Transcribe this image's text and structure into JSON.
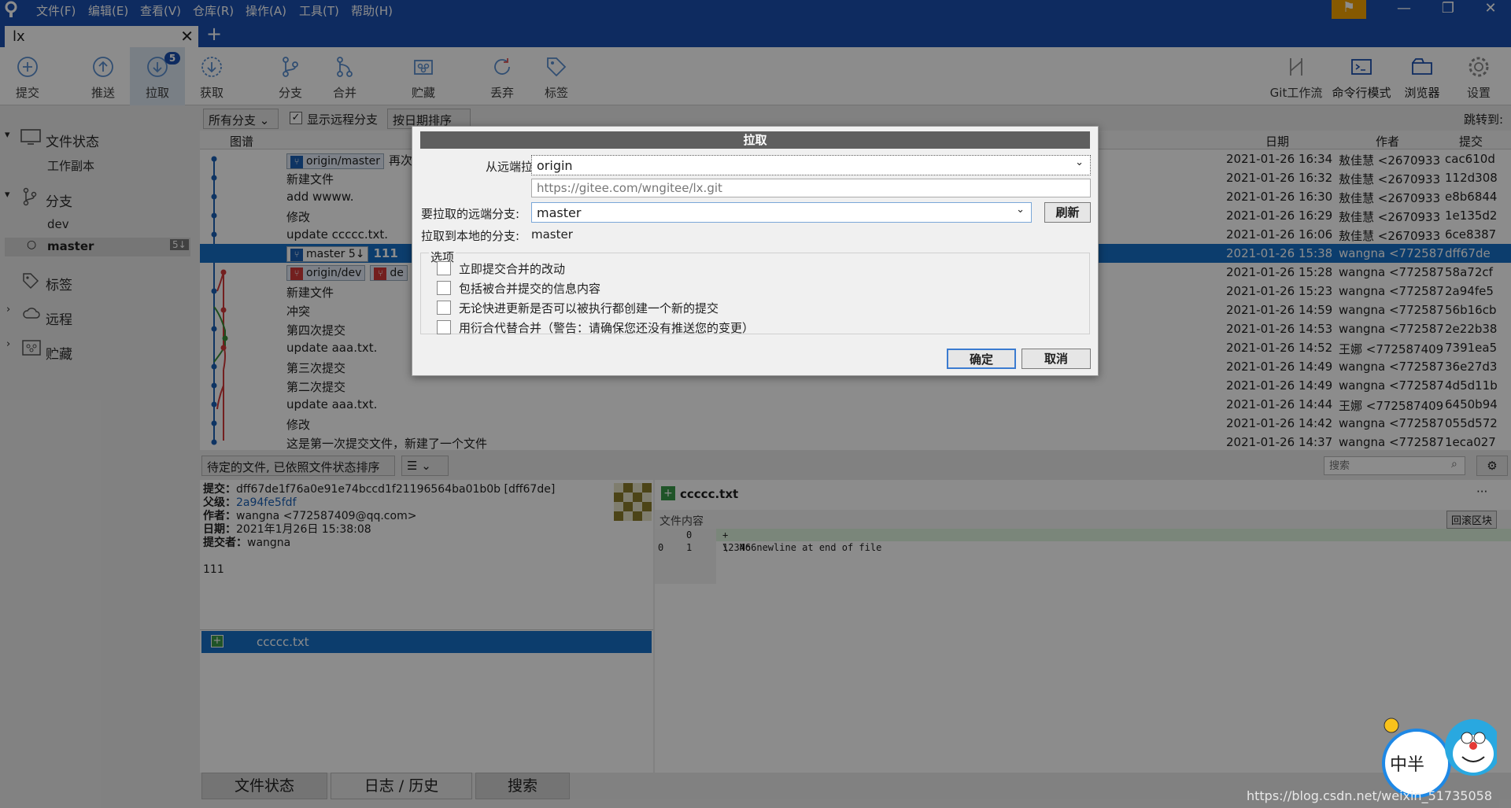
{
  "menu": [
    "文件(F)",
    "编辑(E)",
    "查看(V)",
    "仓库(R)",
    "操作(A)",
    "工具(T)",
    "帮助(H)"
  ],
  "tab": {
    "name": "lx",
    "close": "✕",
    "new": "+"
  },
  "toolbar": {
    "commit": "提交",
    "push": "推送",
    "pull": "拉取",
    "pull_badge": "5",
    "fetch": "获取",
    "branch": "分支",
    "merge": "合并",
    "stash": "贮藏",
    "discard": "丢弃",
    "tag": "标签",
    "gitflow": "Git工作流",
    "terminal": "命令行模式",
    "browser": "浏览器",
    "settings": "设置"
  },
  "sidebar": {
    "file_status": "文件状态",
    "working_copy": "工作副本",
    "branches": "分支",
    "branch_dev": "dev",
    "branch_master": "master",
    "master_badge": "5↓",
    "tags": "标签",
    "remotes": "远程",
    "stashes": "贮藏"
  },
  "filter": {
    "all_branches": "所有分支",
    "show_remote": "显示远程分支",
    "sort": "按日期排序",
    "jump": "跳转到:"
  },
  "list_header": {
    "graph": "图谱",
    "date": "日期",
    "author": "作者",
    "commit": "提交"
  },
  "commits": [
    {
      "ref": "origin/master",
      "msg": "再次",
      "date": "2021-01-26 16:34",
      "author": "敖佳慧 <2670933",
      "hash": "cac610d"
    },
    {
      "msg": "新建文件",
      "date": "2021-01-26 16:32",
      "author": "敖佳慧 <2670933",
      "hash": "112d308"
    },
    {
      "msg": "add wwww.",
      "date": "2021-01-26 16:30",
      "author": "敖佳慧 <2670933",
      "hash": "e8b6844"
    },
    {
      "msg": "修改",
      "date": "2021-01-26 16:29",
      "author": "敖佳慧 <2670933",
      "hash": "1e135d2"
    },
    {
      "msg": "update ccccc.txt.",
      "date": "2021-01-26 16:06",
      "author": "敖佳慧 <2670933",
      "hash": "6ce8387"
    },
    {
      "ref": "master",
      "ref_badge": "5↓",
      "msg": "111",
      "date": "2021-01-26 15:38",
      "author": "wangna <772587",
      "hash": "dff67de"
    },
    {
      "ref": "origin/dev",
      "ref2": "de",
      "msg": "",
      "date": "2021-01-26 15:28",
      "author": "wangna <772587",
      "hash": "58a72cf"
    },
    {
      "msg": "新建文件",
      "date": "2021-01-26 15:23",
      "author": "wangna <772587",
      "hash": "2a94fe5"
    },
    {
      "msg": "冲突",
      "date": "2021-01-26 14:59",
      "author": "wangna <772587",
      "hash": "56b16cb"
    },
    {
      "msg": "第四次提交",
      "date": "2021-01-26 14:53",
      "author": "wangna <772587",
      "hash": "2e22b38"
    },
    {
      "msg": "update aaa.txt.",
      "date": "2021-01-26 14:52",
      "author": "王娜 <772587409",
      "hash": "7391ea5"
    },
    {
      "msg": "第三次提交",
      "date": "2021-01-26 14:49",
      "author": "wangna <772587",
      "hash": "36e27d3"
    },
    {
      "msg": "第二次提交",
      "date": "2021-01-26 14:49",
      "author": "wangna <772587",
      "hash": "4d5d11b"
    },
    {
      "msg": "update aaa.txt.",
      "date": "2021-01-26 14:44",
      "author": "王娜 <772587409",
      "hash": "6450b94"
    },
    {
      "msg": "修改",
      "date": "2021-01-26 14:42",
      "author": "wangna <772587",
      "hash": "055d572"
    },
    {
      "msg": "这是第一次提交文件，新建了一个文件",
      "date": "2021-01-26 14:37",
      "author": "wangna <772587",
      "hash": "1eca027"
    }
  ],
  "bottombar": {
    "sort": "待定的文件, 已依照文件状态排序",
    "search_placeholder": "搜索"
  },
  "details": {
    "commit_label": "提交：",
    "commit": "dff67de1f76a0e91e74bccd1f21196564ba01b0b [dff67de]",
    "parent_label": "父级：",
    "parent": "2a94fe5fdf",
    "author_label": "作者：",
    "author": "wangna <772587409@qq.com>",
    "date_label": "日期：",
    "date": "2021年1月26日 15:38:08",
    "committer_label": "提交者：",
    "committer": "wangna",
    "message": "111"
  },
  "files": [
    {
      "name": "ccccc.txt"
    }
  ],
  "diff": {
    "file": "ccccc.txt",
    "more": "···",
    "section": "文件内容",
    "revert": "回滚区块",
    "lines": [
      {
        "old": "",
        "new": "0",
        "text": "+ 123466",
        "type": "add"
      },
      {
        "old": "0",
        "new": "1",
        "text": "\\  No newline at end of file",
        "type": "ctx"
      }
    ]
  },
  "bottom_tabs": {
    "status": "文件状态",
    "log": "日志 / 历史",
    "search": "搜索"
  },
  "dialog": {
    "title": "拉取",
    "remote_label": "从远端拉取",
    "remote": "origin",
    "url": "https://gitee.com/wngitee/lx.git",
    "branch_label": "要拉取的远端分支:",
    "branch": "master",
    "refresh": "刷新",
    "local_label": "拉取到本地的分支:",
    "local": "master",
    "options_label": "选项",
    "options": [
      "立即提交合并的改动",
      "包括被合并提交的信息内容",
      "无论快进更新是否可以被执行都创建一个新的提交",
      "用衍合代替合并（警告：请确保您还没有推送您的变更）"
    ],
    "ok": "确定",
    "cancel": "取消"
  },
  "ime": {
    "text": "中半"
  },
  "watermark": "https://blog.csdn.net/weixin_51735058",
  "colors": {
    "accent": "#1a4fb0",
    "selection": "#1670c7",
    "flag": "#f5a200"
  }
}
